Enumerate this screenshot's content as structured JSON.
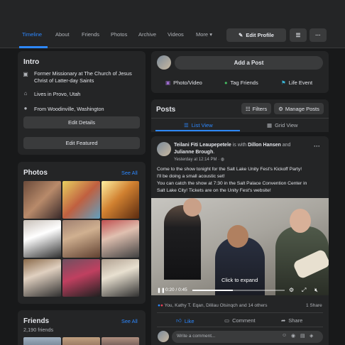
{
  "nav": {
    "tabs": [
      "Timeline",
      "About",
      "Friends",
      "Photos",
      "Archive",
      "Videos",
      "More"
    ],
    "more_caret": "▾",
    "edit_profile": "Edit Profile"
  },
  "intro": {
    "title": "Intro",
    "line1": "Former Missionary at ",
    "line1_link": "The Church of Jesus",
    "line1_link2": "Christ of Latter-day Saints",
    "line2": "Lives in ",
    "line2_link": "Provo, Utah",
    "line3": "From ",
    "line3_link": "Woodinville, Washington",
    "edit_details": "Edit Details",
    "edit_featured": "Edit Featured"
  },
  "photos": {
    "title": "Photos",
    "see_all": "See All"
  },
  "friends": {
    "title": "Friends",
    "count": "2,190 friends",
    "see_all": "See All"
  },
  "composer": {
    "add_post": "Add a Post",
    "photo_video": "Photo/Video",
    "tag_friends": "Tag Friends",
    "life_event": "Life Event"
  },
  "posts": {
    "title": "Posts",
    "filters": "Filters",
    "manage": "Manage Posts",
    "list_view": "List View",
    "grid_view": "Grid View"
  },
  "post": {
    "author": "Teilani Fiti Leaupepetele",
    "with_text": " is with ",
    "with1": "Dillon Hansen",
    "and_text": " and",
    "with2": "Julianne Brough",
    "period": ".",
    "time": "Yesterday at 12:14 PM · ",
    "privacy_icon": "globe-icon",
    "text_line1": "Come to the show tonight for the Salt Lake Unity Fest's Kickoff Party!",
    "text_line2": "I'll be doing a small acoustic set!",
    "text_line3": "You can catch the show at 7:30 in the Salt Palace Convention Center in",
    "text_line4": "Salt Lake City! Tickets are on the Unity Fest's website!",
    "video_time": "0:20 / 0:45",
    "video_progress": 0.44,
    "click_to_expand": "Click to expand",
    "reactions": "You, Kathy T. Eqan, Dililau Olsinqch and 14 others",
    "shares": "1 Share",
    "like": "Like",
    "comment": "Comment",
    "share": "Share",
    "comment_placeholder": "Write a comment..."
  },
  "colors": {
    "accent": "#2d88ff",
    "card": "#242526",
    "background": "#18191a"
  }
}
